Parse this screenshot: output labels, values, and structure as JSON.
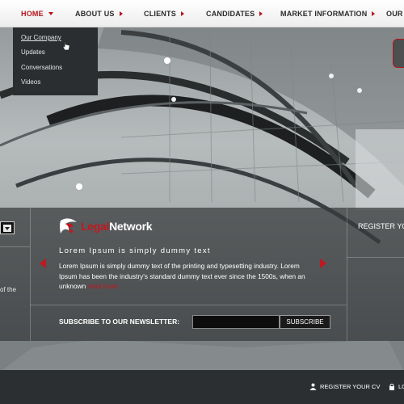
{
  "nav": {
    "items": [
      {
        "label": "HOME",
        "active": true
      },
      {
        "label": "ABOUT US"
      },
      {
        "label": "CLIENTS"
      },
      {
        "label": "CANDIDATES"
      },
      {
        "label": "MARKET INFORMATION"
      },
      {
        "label": "OUR I"
      }
    ],
    "dropdown": [
      "Our Company",
      "Updates",
      "Conversations",
      "Videos"
    ]
  },
  "hero": {
    "logo": {
      "part1": "Legal",
      "part2": "Network"
    },
    "tagline": "Lorem Ipsum is simply dummy text",
    "body": "Lorem Ipsum is simply dummy text of the printing and typesetting industry. Lorem Ipsum has been the industry's standard dummy text ever since the 1500s, when an unknown ",
    "read_more": "read more",
    "left_text": "of the",
    "register_title": "REGISTER YOU"
  },
  "newsletter": {
    "label": "SUBSCRIBE TO OUR NEWSLETTER:",
    "placeholder": "",
    "button": "SUBSCRIBE"
  },
  "footer": {
    "register_cv": "REGISTER YOUR CV",
    "login": "LO"
  },
  "colors": {
    "accent": "#b5141b",
    "nav_bg": "#f4f4f4",
    "panel": "#2b2e30"
  }
}
